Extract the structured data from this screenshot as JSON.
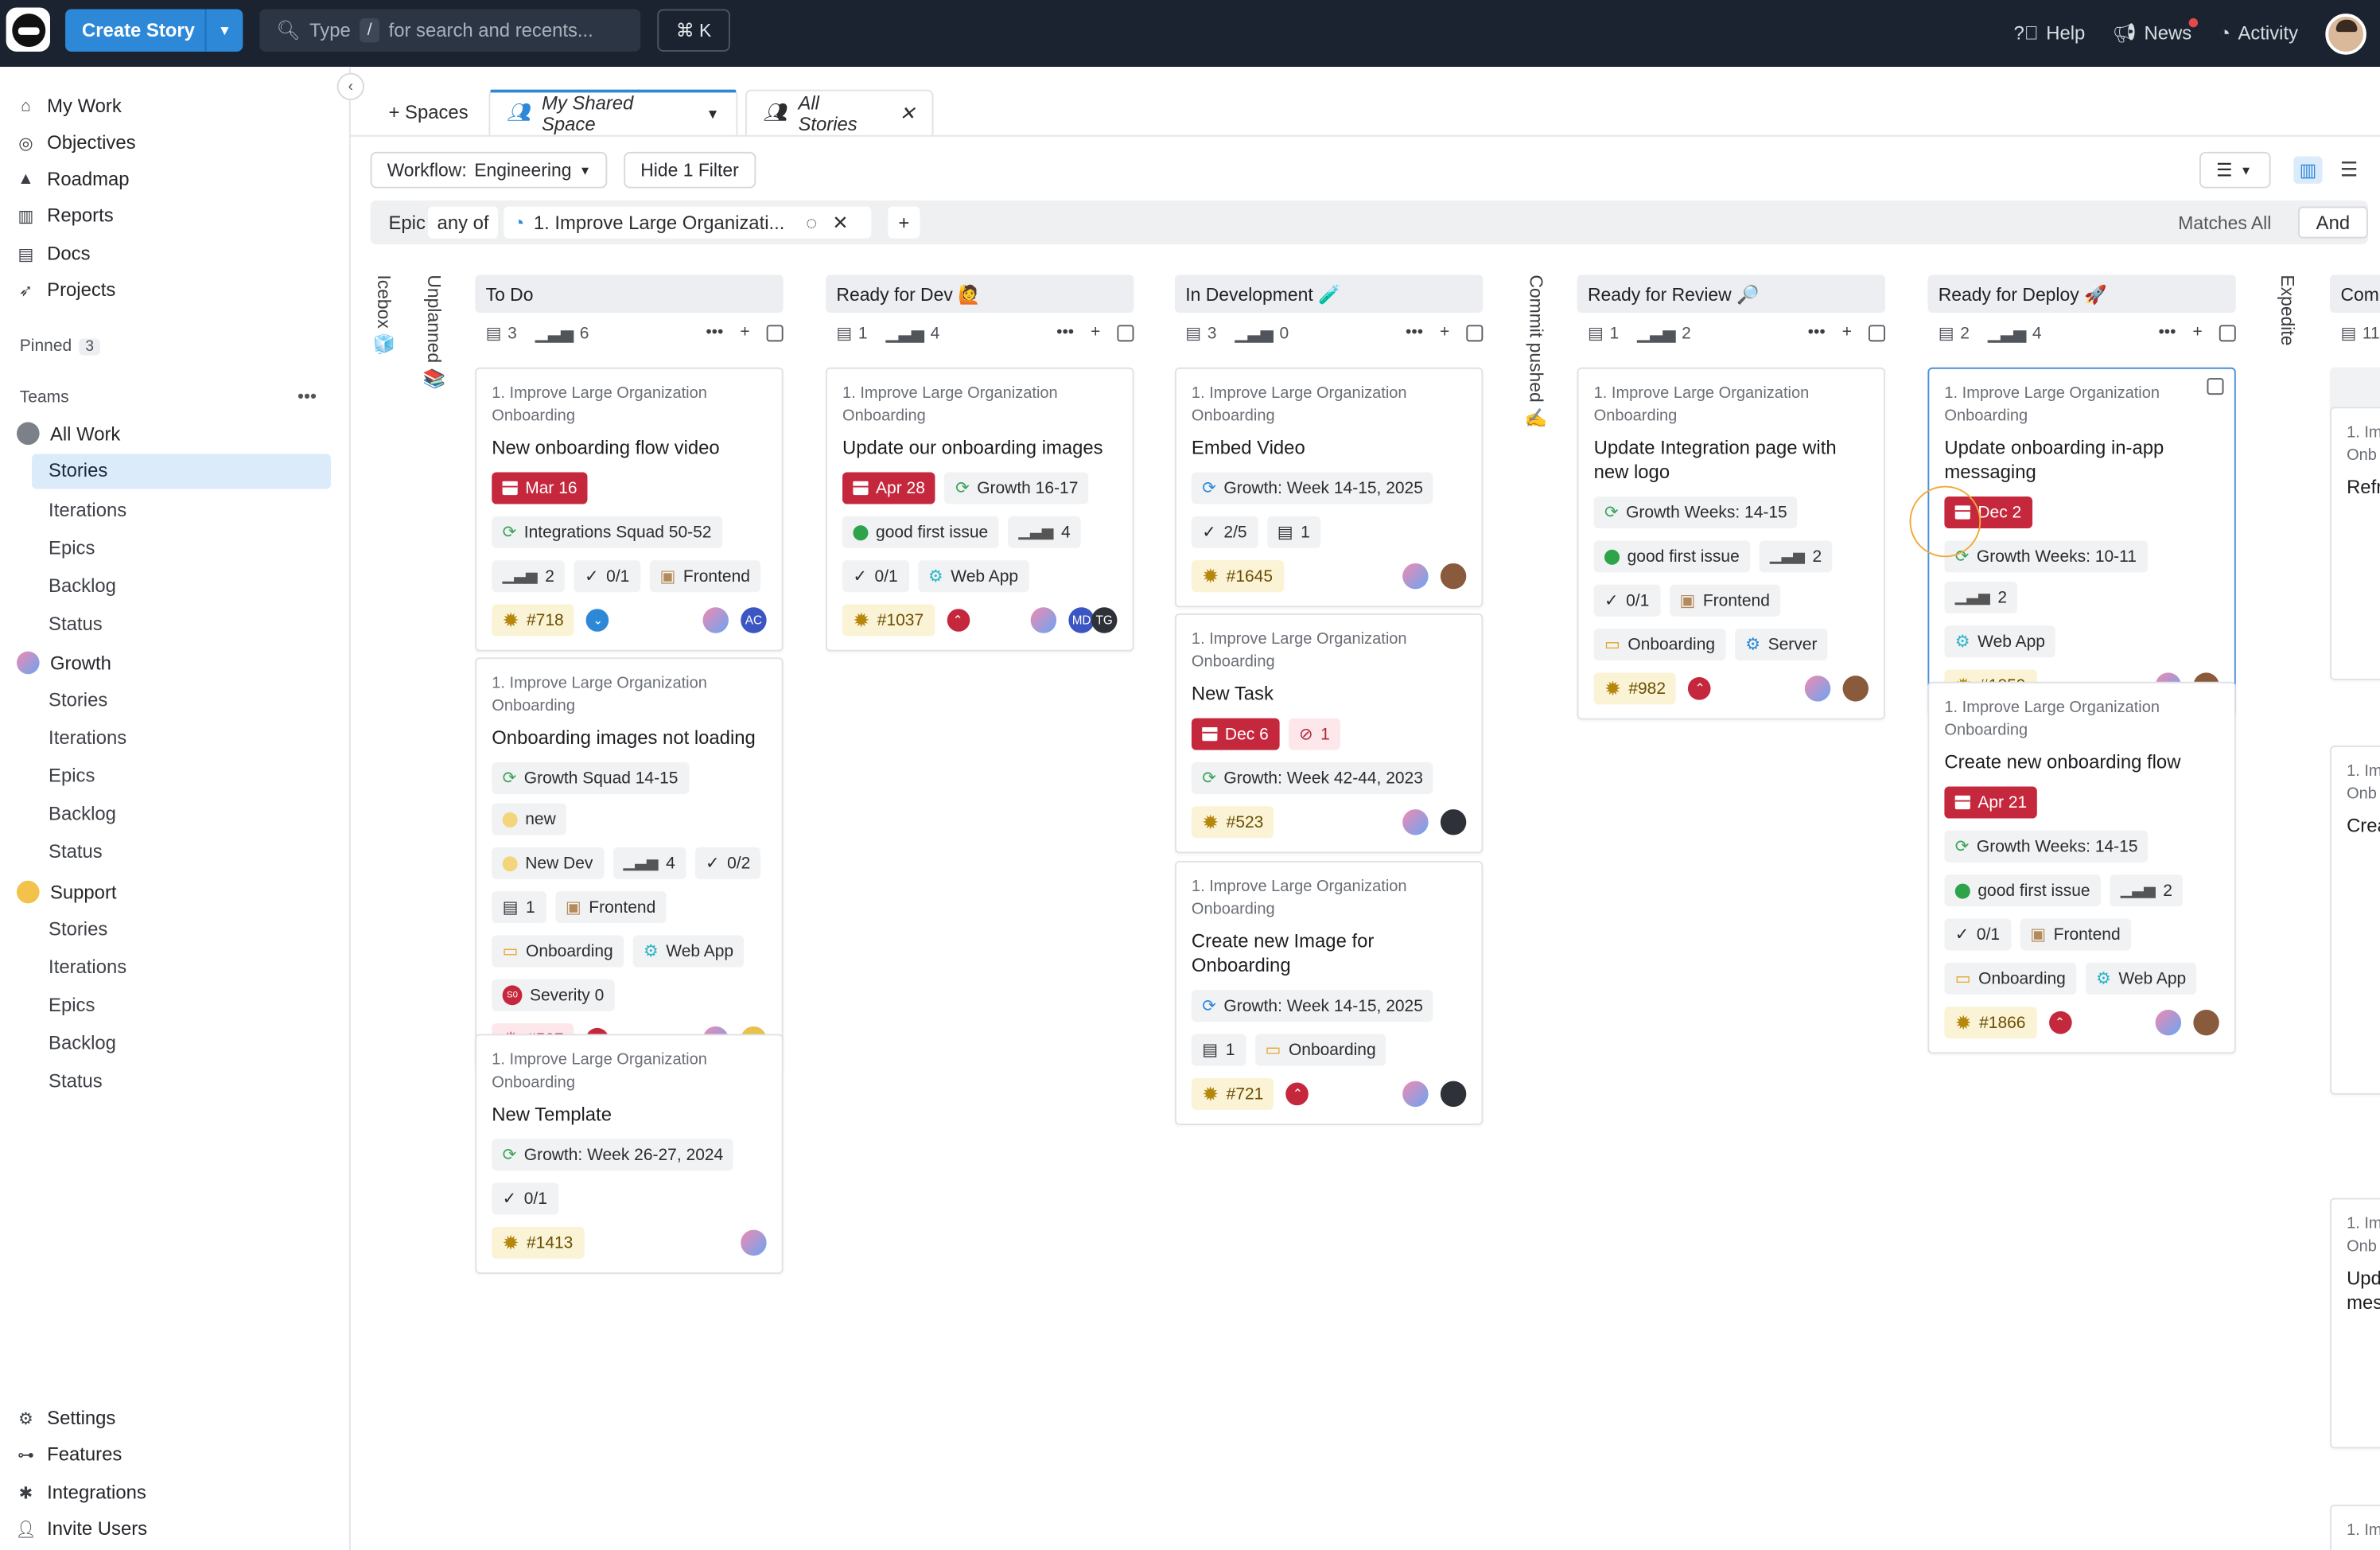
{
  "topbar": {
    "create_label": "Create Story",
    "search_pre": "Type",
    "search_key": "/",
    "search_post": "for search and recents...",
    "cmdk": "⌘ K",
    "help": "Help",
    "news": "News",
    "activity": "Activity"
  },
  "sidebar": {
    "main": [
      "My Work",
      "Objectives",
      "Roadmap",
      "Reports",
      "Docs",
      "Projects"
    ],
    "pinned_label": "Pinned",
    "pinned_count": "3",
    "teams_label": "Teams",
    "all_work": "All Work",
    "all_work_items": [
      "Stories",
      "Iterations",
      "Epics",
      "Backlog",
      "Status"
    ],
    "growth": "Growth",
    "growth_items": [
      "Stories",
      "Iterations",
      "Epics",
      "Backlog",
      "Status"
    ],
    "support": "Support",
    "support_items": [
      "Stories",
      "Iterations",
      "Epics",
      "Backlog",
      "Status"
    ],
    "bottom": [
      "Settings",
      "Features",
      "Integrations",
      "Invite Users"
    ]
  },
  "tabs": {
    "spaces": "+ Spaces",
    "shared": "My Shared Space",
    "all": "All Stories"
  },
  "toolbar": {
    "workflow_label": "Workflow:",
    "workflow_value": "Engineering",
    "hide_filter": "Hide 1 Filter"
  },
  "filter": {
    "field": "Epic",
    "op": "any of",
    "value": "1. Improve Large Organizati...",
    "matches": "Matches All",
    "and": "And"
  },
  "vertical": {
    "icebox": "Icebox",
    "unplanned": "Unplanned",
    "commit": "Commit pushed",
    "expedite": "Expedite"
  },
  "columns": [
    {
      "name": "To Do",
      "stories": "3",
      "points": "6"
    },
    {
      "name": "Ready for Dev 🙋",
      "stories": "1",
      "points": "4"
    },
    {
      "name": "In Development 🧪",
      "stories": "3",
      "points": "0"
    },
    {
      "name": "Ready for Review 🔎",
      "stories": "1",
      "points": "2"
    },
    {
      "name": "Ready for Deploy 🚀",
      "stories": "2",
      "points": "4"
    },
    {
      "name": "Comp",
      "stories": "11",
      "points": ""
    }
  ],
  "epic_text": "1. Improve Large Organization Onboarding",
  "cards": {
    "c1": {
      "title": "New onboarding flow video",
      "date": "Mar 16",
      "iter": "Integrations Squad 50-52",
      "est": "2",
      "tasks": "0/1",
      "tag": "Frontend",
      "id": "#718",
      "av": "AC"
    },
    "c2": {
      "title": "Onboarding images not loading",
      "iter": "Growth Squad 14-15",
      "s1": "new",
      "s2": "New Dev",
      "est": "4",
      "tasks": "0/2",
      "docs": "1",
      "tag": "Frontend",
      "l1": "Onboarding",
      "l2": "Web App",
      "sev": "Severity 0",
      "id": "#537",
      "av": "AS"
    },
    "c3": {
      "title": "New Template",
      "iter": "Growth: Week 26-27, 2024",
      "tasks": "0/1",
      "id": "#1413"
    },
    "c4": {
      "title": "Update our onboarding images",
      "date": "Apr 28",
      "iter": "Growth 16-17",
      "state": "good first issue",
      "est": "4",
      "tasks": "0/1",
      "tag": "Web App",
      "id": "#1037",
      "av1": "MD",
      "av2": "TG"
    },
    "c5": {
      "title": "Embed Video",
      "iter": "Growth: Week 14-15, 2025",
      "tasks": "2/5",
      "docs": "1",
      "id": "#1645"
    },
    "c6": {
      "title": "New Task",
      "date": "Dec 6",
      "block": "1",
      "iter": "Growth: Week 42-44, 2023",
      "id": "#523"
    },
    "c7": {
      "title": "Create new Image for Onboarding",
      "iter": "Growth: Week 14-15, 2025",
      "docs": "1",
      "tag": "Onboarding",
      "id": "#721"
    },
    "c8": {
      "title": "Update Integration page with new logo",
      "iter": "Growth Weeks: 14-15",
      "state": "good first issue",
      "est": "2",
      "tasks": "0/1",
      "tag": "Frontend",
      "l1": "Onboarding",
      "l2": "Server",
      "id": "#982"
    },
    "c9": {
      "title": "Update onboarding in-app messaging",
      "date": "Dec 2",
      "iter": "Growth Weeks: 10-11",
      "est": "2",
      "tag": "Web App",
      "id": "#1859"
    },
    "c10": {
      "title": "Create new onboarding flow",
      "date": "Apr 21",
      "iter": "Growth Weeks: 14-15",
      "state": "good first issue",
      "est": "2",
      "tasks": "0/1",
      "tag": "Frontend",
      "l1": "Onboarding",
      "l2": "Web App",
      "id": "#1866"
    }
  },
  "comp_cut": {
    "t1": "1. Im",
    "t2": "Onb",
    "t3": "Refr",
    "t4": "Crea",
    "t5": "Upd",
    "t6": "mes"
  }
}
